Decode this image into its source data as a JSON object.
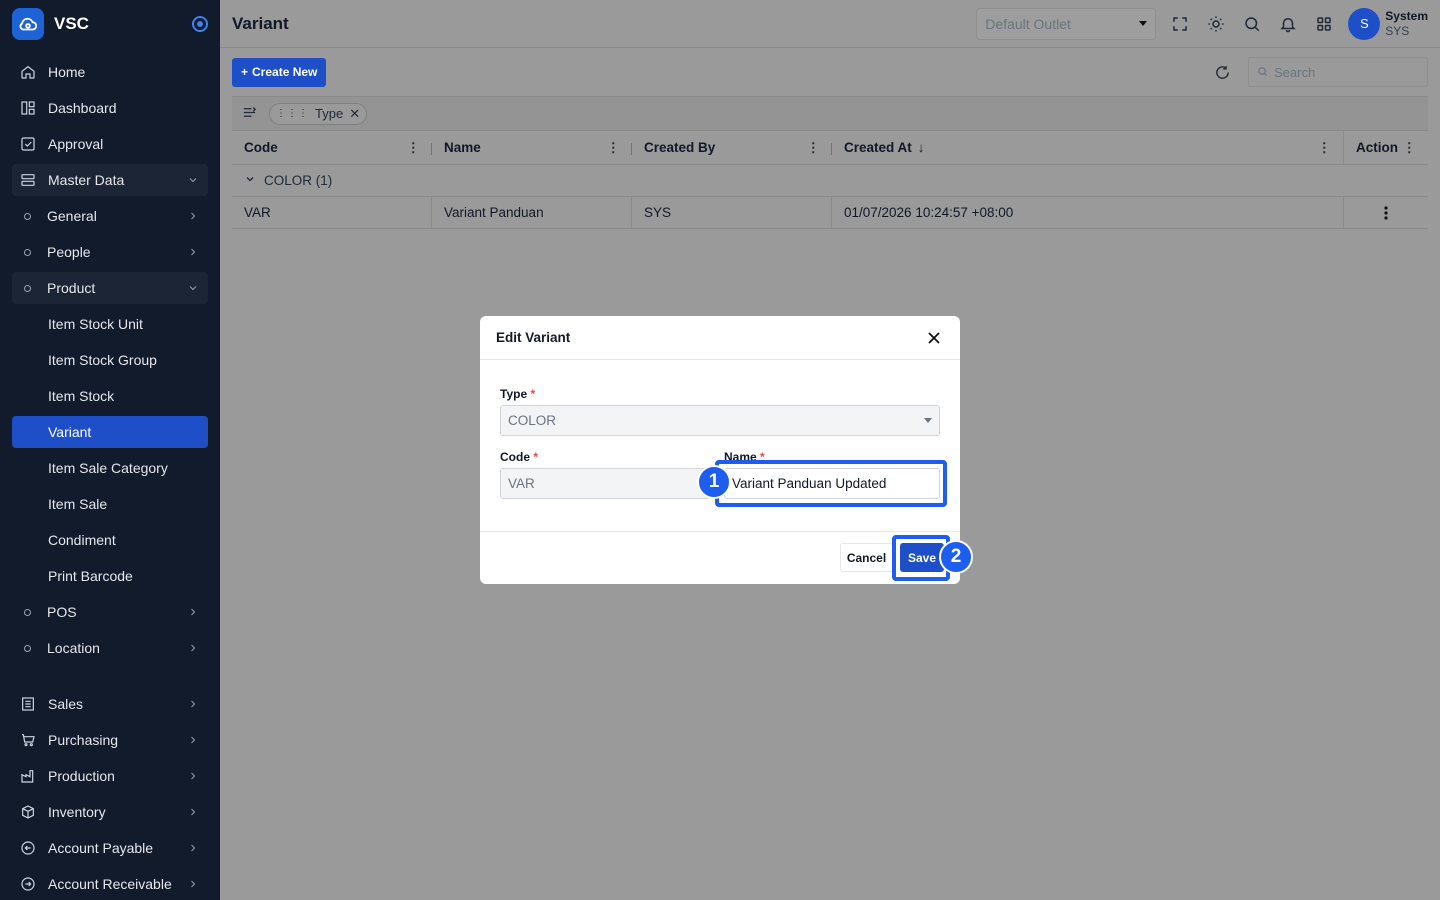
{
  "brand": {
    "name": "VSC"
  },
  "sidebar": {
    "items": [
      {
        "label": "Home",
        "icon": "home-icon"
      },
      {
        "label": "Dashboard",
        "icon": "dashboard-icon"
      },
      {
        "label": "Approval",
        "icon": "approval-icon"
      },
      {
        "label": "Master Data",
        "icon": "server-icon",
        "expanded": true
      },
      {
        "label": "General"
      },
      {
        "label": "People"
      },
      {
        "label": "Product",
        "expanded": true
      },
      {
        "label": "Item Stock Unit"
      },
      {
        "label": "Item Stock Group"
      },
      {
        "label": "Item Stock"
      },
      {
        "label": "Variant",
        "active": true
      },
      {
        "label": "Item Sale Category"
      },
      {
        "label": "Item Sale"
      },
      {
        "label": "Condiment"
      },
      {
        "label": "Print Barcode"
      },
      {
        "label": "POS"
      },
      {
        "label": "Location"
      },
      {
        "label": "Sales",
        "icon": "sales-icon"
      },
      {
        "label": "Purchasing",
        "icon": "cart-icon"
      },
      {
        "label": "Production",
        "icon": "factory-icon"
      },
      {
        "label": "Inventory",
        "icon": "box-icon"
      },
      {
        "label": "Account Payable",
        "icon": "arrow-left-circle-icon"
      },
      {
        "label": "Account Receivable",
        "icon": "arrow-right-circle-icon"
      }
    ]
  },
  "header": {
    "title": "Variant",
    "outlet_placeholder": "Default Outlet",
    "user": {
      "initial": "S",
      "name": "System",
      "code": "SYS"
    }
  },
  "toolbar": {
    "create_label": "Create New",
    "search_placeholder": "Search"
  },
  "groupbar": {
    "chip_label": "Type"
  },
  "table": {
    "columns": [
      "Code",
      "Name",
      "Created By",
      "Created At",
      "Action"
    ],
    "group_label": "COLOR (1)",
    "rows": [
      {
        "code": "VAR",
        "name": "Variant Panduan",
        "created_by": "SYS",
        "created_at": "01/07/2026 10:24:57 +08:00"
      }
    ]
  },
  "modal": {
    "title": "Edit Variant",
    "type_label": "Type",
    "type_value": "COLOR",
    "code_label": "Code",
    "code_value": "VAR",
    "name_label": "Name",
    "name_value": "Variant Panduan Updated",
    "required_mark": "*",
    "cancel_label": "Cancel",
    "save_label": "Save"
  },
  "steps": {
    "step1": "1",
    "step2": "2"
  },
  "colors": {
    "primary": "#1e4fc9",
    "highlight": "#1d5ef0",
    "sidebar_bg": "#121b2c"
  }
}
